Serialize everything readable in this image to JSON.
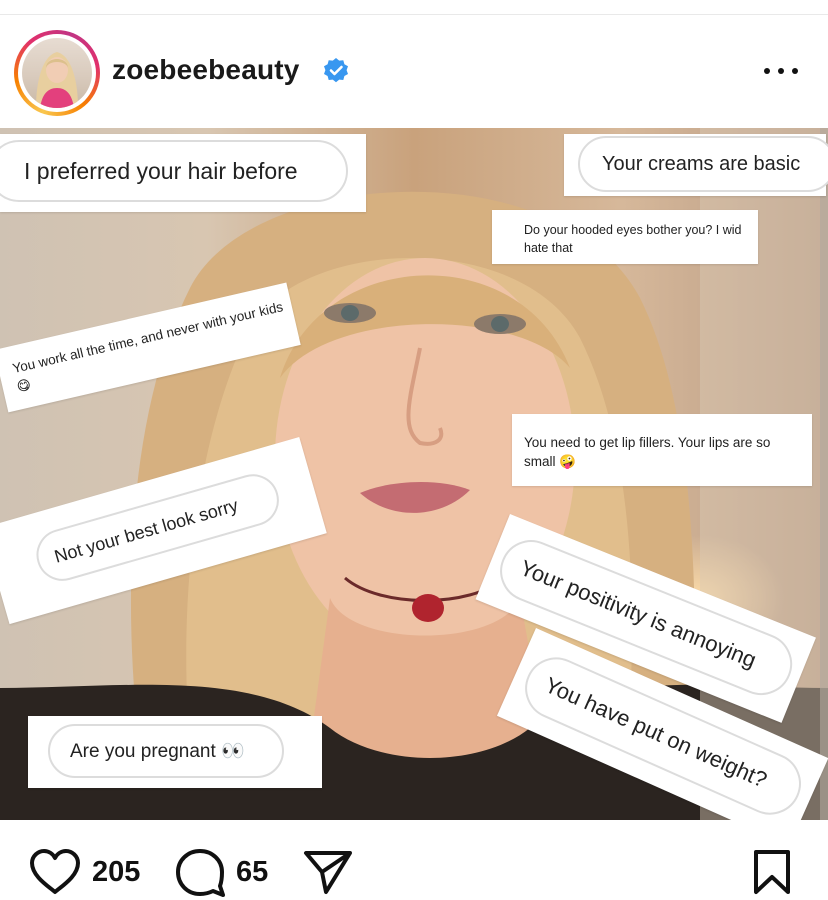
{
  "post": {
    "username": "zoebeebeauty",
    "verified_icon": "verified-badge-icon",
    "more_icon": "more-options-icon"
  },
  "image": {
    "comments": [
      {
        "id": "hair",
        "text": "I preferred your hair before"
      },
      {
        "id": "creams",
        "text": "Your creams are basic"
      },
      {
        "id": "eyes",
        "text": "Do your hooded eyes bother you? I wid hate that"
      },
      {
        "id": "kids",
        "text": "You work all the time, and never with your kids 😋"
      },
      {
        "id": "lips",
        "text": "You need to get lip fillers. Your lips are so small 🤪"
      },
      {
        "id": "look",
        "text": "Not your best look sorry"
      },
      {
        "id": "positivity",
        "text": "Your positivity is annoying"
      },
      {
        "id": "weight",
        "text": "You have put on weight?"
      },
      {
        "id": "pregnant",
        "text": "Are you pregnant 👀"
      }
    ]
  },
  "actions": {
    "likes": "205",
    "comments": "65",
    "like_icon": "heart-icon",
    "comment_icon": "comment-bubble-icon",
    "share_icon": "paper-plane-icon",
    "save_icon": "bookmark-icon"
  },
  "colors": {
    "verified": "#3897f0",
    "story_ring": [
      "#f9c74f",
      "#e1306c",
      "#c13584"
    ]
  }
}
